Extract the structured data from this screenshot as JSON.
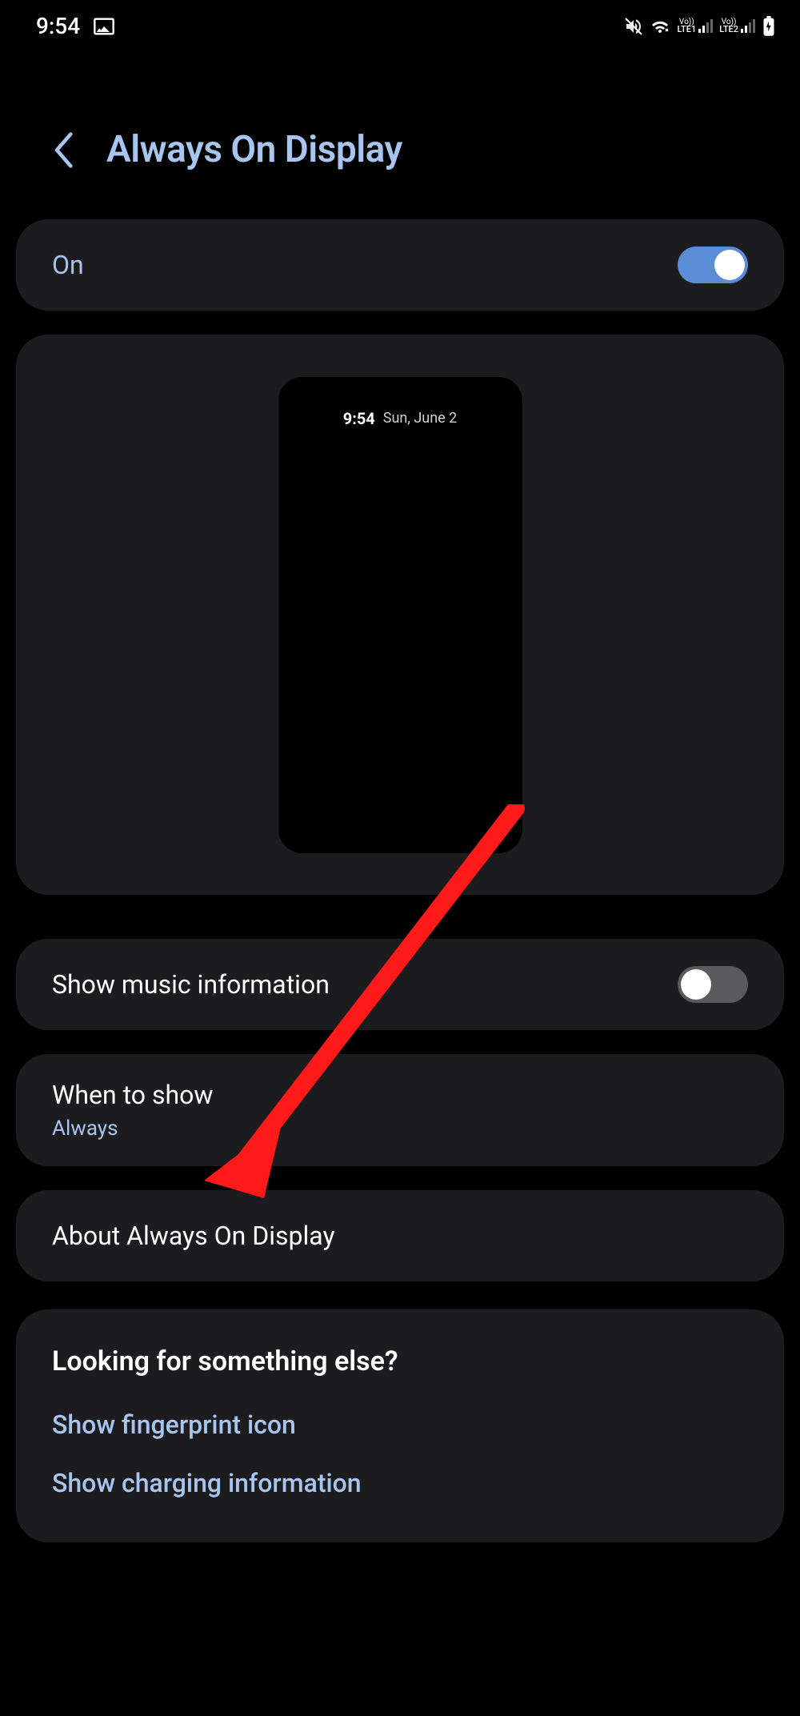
{
  "status_bar": {
    "time": "9:54",
    "sim1_label": "LTE1",
    "sim2_label": "LTE2",
    "vo_label": "Vo))"
  },
  "header": {
    "title": "Always On Display"
  },
  "on_card": {
    "label": "On",
    "enabled": true
  },
  "preview": {
    "time": "9:54",
    "date": "Sun, June 2"
  },
  "music_info": {
    "label": "Show music information",
    "enabled": false
  },
  "when_to_show": {
    "label": "When to show",
    "value": "Always"
  },
  "about": {
    "label": "About Always On Display"
  },
  "looking": {
    "title": "Looking for something else?",
    "links": [
      "Show fingerprint icon",
      "Show charging information"
    ]
  }
}
